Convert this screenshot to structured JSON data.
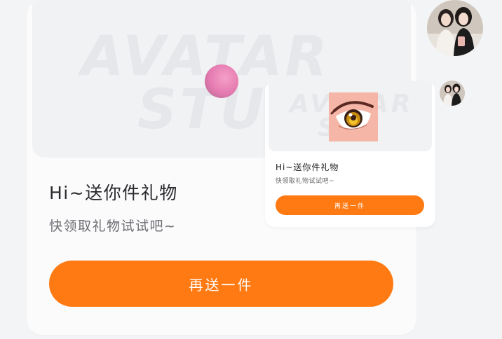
{
  "main_card": {
    "watermark_line1": "AVATAR",
    "watermark_line2": "STU",
    "title": "Hi~送你件礼物",
    "subtitle": "快领取礼物试试吧~",
    "button_label": "再送一件"
  },
  "preview_card": {
    "watermark_line1": "AVATAR",
    "watermark_line2": "STU",
    "title": "Hi~送你件礼物",
    "subtitle": "快领取礼物试试吧~",
    "button_label": "再送一件",
    "gift_icon": "anime-eye-icon"
  },
  "decoration": {
    "ball_icon": "pink-ball-icon"
  },
  "avatars": {
    "large": "user-avatar",
    "small": "user-avatar-small"
  },
  "colors": {
    "accent": "#ff7a12",
    "page_bg": "#f3f4f6",
    "banner_bg": "#f1f2f4",
    "watermark": "#e6e7ea",
    "ball": "#e57ab0",
    "thumb_bg": "#f6b6a7"
  }
}
